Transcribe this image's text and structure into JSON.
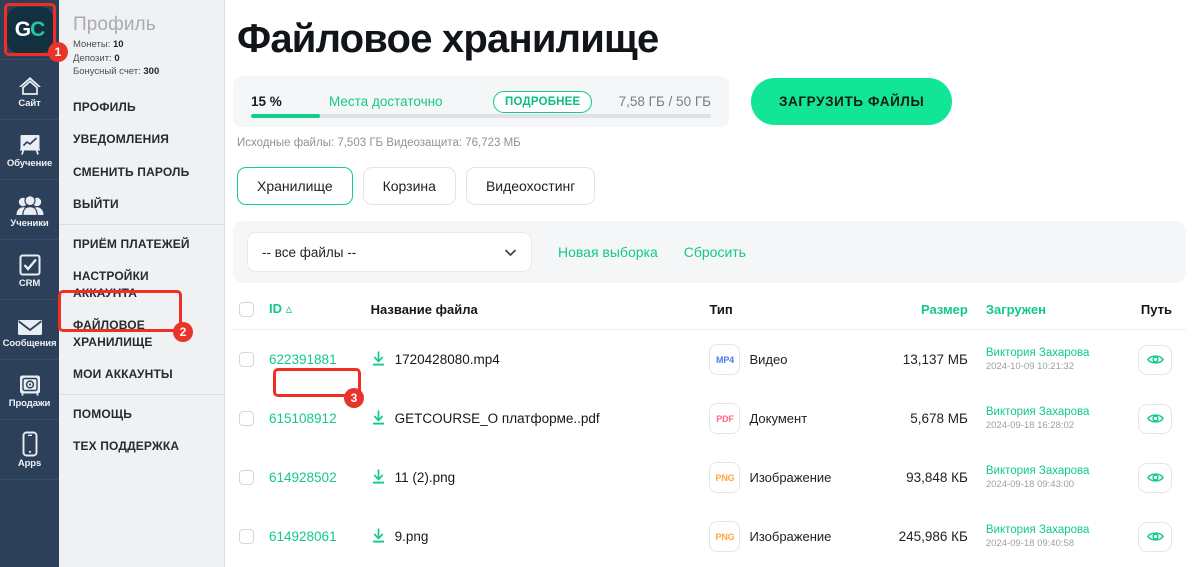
{
  "brand": {
    "logo_g": "G",
    "logo_c": "C",
    "accent_green": "#12c98b",
    "accent_bright_green": "#12e596",
    "rail_navy": "#2d4059",
    "annotation_red": "#ef2f23"
  },
  "rail": {
    "items": [
      {
        "label": "Сайт",
        "icon": "house-icon"
      },
      {
        "label": "Обучение",
        "icon": "easel-chart-icon"
      },
      {
        "label": "Ученики",
        "icon": "people-icon"
      },
      {
        "label": "CRM",
        "icon": "checkbox-check-icon"
      },
      {
        "label": "Сообщения",
        "icon": "envelope-icon"
      },
      {
        "label": "Продажи",
        "icon": "safe-box-icon"
      },
      {
        "label": "Apps",
        "icon": "mobile-phone-icon"
      }
    ]
  },
  "nav": {
    "profile_title": "Профиль",
    "stats": [
      {
        "label": "Монеты:",
        "value": "10"
      },
      {
        "label": "Депозит:",
        "value": "0"
      },
      {
        "label": "Бонусный счет:",
        "value": "300"
      }
    ],
    "items": [
      {
        "label": "ПРОФИЛЬ"
      },
      {
        "label": "УВЕДОМЛЕНИЯ"
      },
      {
        "label": "СМЕНИТЬ ПАРОЛЬ"
      },
      {
        "label": "ВЫЙТИ"
      },
      {
        "label": "ПРИЁМ ПЛАТЕЖЕЙ"
      },
      {
        "label": "НАСТРОЙКИ АККАУНТА"
      },
      {
        "label": "ФАЙЛОВОЕ ХРАНИЛИЩЕ"
      },
      {
        "label": "МОИ АККАУНТЫ"
      },
      {
        "label": "ПОМОЩЬ"
      },
      {
        "label": "ТЕХ ПОДДЕРЖКА"
      }
    ]
  },
  "page": {
    "title": "Файловое хранилище"
  },
  "quota": {
    "percent_label": "15 %",
    "percent_value": 15,
    "status_message": "Места достаточно",
    "details_button": "ПОДРОБНЕЕ",
    "size_used_total": "7,58 ГБ / 50 ГБ",
    "upload_button": "ЗАГРУЗИТЬ ФАЙЛЫ",
    "note": "Исходные файлы: 7,503 ГБ Видеозащита: 76,723 МБ"
  },
  "tabs": [
    {
      "label": "Хранилище",
      "active": true
    },
    {
      "label": "Корзина",
      "active": false
    },
    {
      "label": "Видеохостинг",
      "active": false
    }
  ],
  "filter": {
    "select_value": "-- все файлы --",
    "new_selection_link": "Новая выборка",
    "reset_link": "Сбросить",
    "chevron_icon": "chevron-down-icon"
  },
  "table": {
    "headers": {
      "id": "ID",
      "id_sort_icon": "sort-ascending-caret",
      "name": "Название файла",
      "type": "Тип",
      "size": "Размер",
      "uploaded": "Загружен",
      "path": "Путь"
    },
    "rows": [
      {
        "id": "622391881",
        "filename": "1720428080.mp4",
        "format": "MP4",
        "type": "Видео",
        "size": "13,137 МБ",
        "uploader": "Виктория Захарова",
        "uploaded_at": "2024-10-09 10:21:32",
        "format_color": "#4b7bec"
      },
      {
        "id": "615108912",
        "filename": "GETCOURSE_О платформе..pdf",
        "format": "PDF",
        "type": "Документ",
        "size": "5,678 МБ",
        "uploader": "Виктория Захарова",
        "uploaded_at": "2024-09-18 16:28:02",
        "format_color": "#ff6b7a"
      },
      {
        "id": "614928502",
        "filename": "11 (2).png",
        "format": "PNG",
        "type": "Изображение",
        "size": "93,848 КБ",
        "uploader": "Виктория Захарова",
        "uploaded_at": "2024-09-18 09:43:00",
        "format_color": "#ffa63d"
      },
      {
        "id": "614928061",
        "filename": "9.png",
        "format": "PNG",
        "type": "Изображение",
        "size": "245,986 КБ",
        "uploader": "Виктория Захарова",
        "uploaded_at": "2024-09-18 09:40:58",
        "format_color": "#ffa63d"
      }
    ]
  },
  "annotations": [
    {
      "number": "1",
      "target": "gc-logo"
    },
    {
      "number": "2",
      "target": "nav-item-file-storage"
    },
    {
      "number": "3",
      "target": "first-row-id"
    }
  ]
}
